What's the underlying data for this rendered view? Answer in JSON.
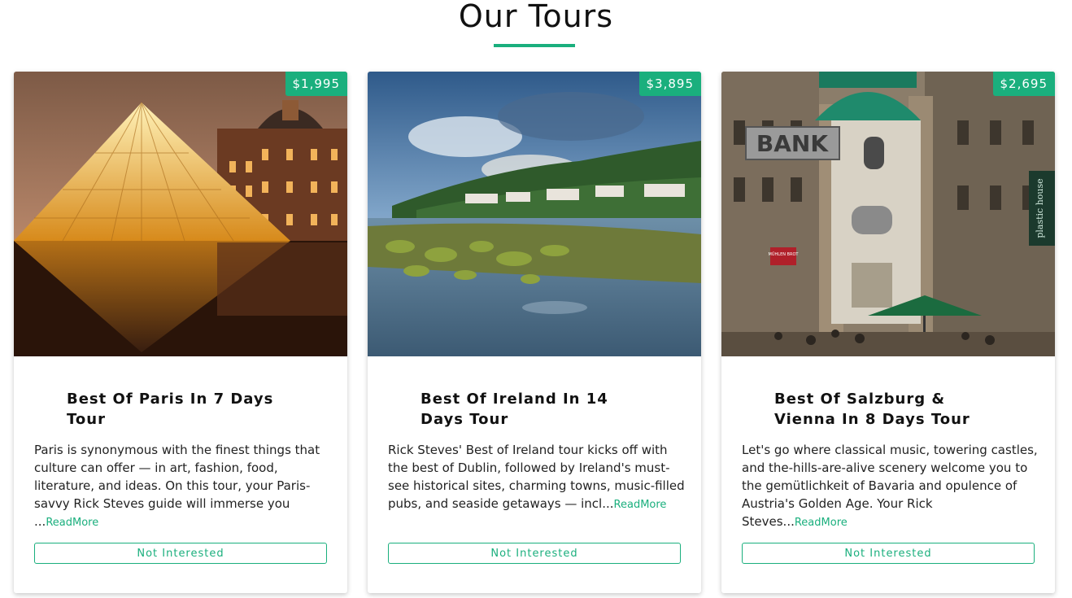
{
  "section": {
    "title": "Our Tours",
    "accent_color": "#1aaf7d"
  },
  "tours": [
    {
      "price": "$1,995",
      "title": "Best Of Paris In 7 Days Tour",
      "description": "Paris is synonymous with the finest things that culture can offer — in art, fashion, food, literature, and ideas. On this tour, your Paris-savvy Rick Steves guide will immerse you ...",
      "read_more": "ReadMore",
      "button": "Not Interested",
      "image": "paris-louvre-pyramid-photo"
    },
    {
      "price": "$3,895",
      "title": "Best Of Ireland In 14 Days Tour",
      "description": "Rick Steves' Best of Ireland tour kicks off with the best of Dublin, followed by Ireland's must-see historical sites, charming towns, music-filled pubs, and seaside getaways — incl...",
      "read_more": "ReadMore",
      "button": "Not Interested",
      "image": "ireland-coastline-photo"
    },
    {
      "price": "$2,695",
      "title": "Best Of Salzburg & Vienna In 8 Days Tour",
      "description": "Let's go where classical music, towering castles, and the-hills-are-alive scenery welcome you to the gemütlichkeit of Bavaria and opulence of Austria's Golden Age. Your Rick Steves...",
      "read_more": "ReadMore",
      "button": "Not Interested",
      "image": "vienna-street-photo",
      "signs": [
        "BANK",
        "MÜHLEN BROT",
        "plastic house"
      ]
    }
  ]
}
